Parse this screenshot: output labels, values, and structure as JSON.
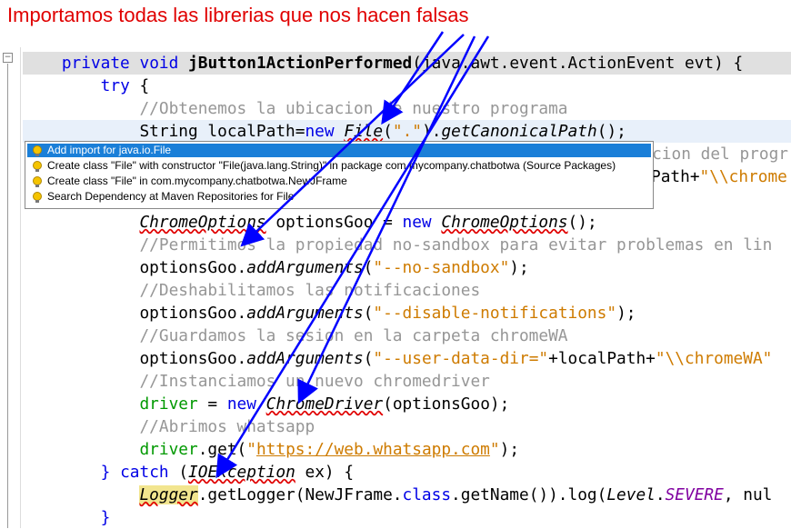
{
  "annotation": "Importamos todas las librerias que nos hacen falsas",
  "code": {
    "l0": [
      "private",
      " ",
      "void",
      " ",
      "jButton1ActionPerformed",
      "(java.awt.event.ActionEvent evt) {"
    ],
    "l1": [
      "try",
      " {"
    ],
    "l2": "//Obtenemos la ubicacion de nuestro programa",
    "l3": [
      "String localPath=",
      "new",
      " ",
      "File",
      "(",
      ".\"",
      ").",
      "getCanonicalPath",
      "();"
    ],
    "l4": "//Obtenemos la ubicacion del progr",
    "l5": [
      "Path+",
      "\"\\\\chrome"
    ],
    "l7": [
      "ChromeOptions",
      " optionsGoo = ",
      "new",
      " ",
      "ChromeOptions",
      "();"
    ],
    "l8": "//Permitimos la propiedad no-sandbox para evitar problemas en lin",
    "l9": [
      "optionsGoo.",
      "addArguments",
      "(",
      "\"--no-sandbox\"",
      ");"
    ],
    "l10": "//Deshabilitamos las notificaciones",
    "l11": [
      "optionsGoo.",
      "addArguments",
      "(",
      "\"--disable-notifications\"",
      ");"
    ],
    "l12": "//Guardamos la sesion en la carpeta chromeWA",
    "l13": [
      "optionsGoo.",
      "addArguments",
      "(",
      "\"--user-data-dir=\"",
      "+localPath+",
      "\"\\\\chromeWA\""
    ],
    "l14": "//Instanciamos un nuevo chromedriver",
    "l15": [
      "driver",
      " = ",
      "new",
      " ",
      "ChromeDriver",
      "(optionsGoo);"
    ],
    "l16": "//Abrimos whatsapp",
    "l17": [
      "driver",
      ".get(",
      "\"",
      "https://web.whatsapp.com",
      "\"",
      ");"
    ],
    "l18": [
      "} ",
      "catch",
      " (",
      "IOException",
      " ex) {"
    ],
    "l19": [
      "Logger",
      ".getLogger(NewJFrame.",
      "class",
      ".getName()).log(",
      "Level",
      ".",
      "SEVERE",
      ", nul"
    ],
    "l20": "}"
  },
  "popup": {
    "items": [
      "Add import for java.io.File",
      "Create class \"File\" with constructor \"File(java.lang.String)\" in package com.mycompany.chatbotwa (Source Packages)",
      "Create class \"File\" in com.mycompany.chatbotwa.NewJFrame",
      "Search Dependency at Maven Repositories for File"
    ],
    "selected_index": 0,
    "icon": "lightbulb-icon"
  },
  "colors": {
    "annotation": "#e00000",
    "arrows": "#0000ff",
    "selection": "#1a7fd8",
    "keyword": "#0000e6",
    "string": "#ce7b00"
  }
}
